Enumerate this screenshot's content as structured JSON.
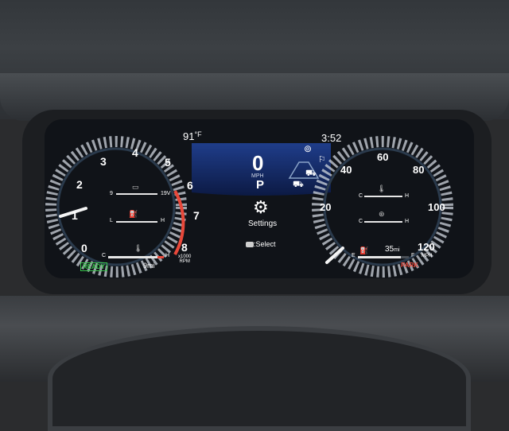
{
  "top": {
    "temperature": "91",
    "temp_unit": "°F",
    "time": "3:52"
  },
  "left_gauge": {
    "ticks": [
      "0",
      "1",
      "2",
      "3",
      "4",
      "5",
      "6",
      "7",
      "8"
    ],
    "unit_line1": "x1000",
    "unit_line2": "RPM",
    "ready": "READY",
    "trip": "9mi",
    "battery": {
      "low": "9",
      "high": "19V"
    },
    "oil": {
      "low": "L",
      "high": "H"
    },
    "coolant": {
      "low": "C",
      "high": "H"
    }
  },
  "center": {
    "speed": "0",
    "speed_unit": "MPH",
    "gear": "P",
    "menu_label": "Settings",
    "select_hint": ":Select",
    "select_icon": "ok-button-icon"
  },
  "right_gauge": {
    "ticks": [
      "20",
      "40",
      "60",
      "80",
      "100",
      "120"
    ],
    "unit": "MPH",
    "fuel_range": "35",
    "fuel_range_unit": "mi",
    "park": "PARK",
    "fuel": {
      "low": "E",
      "high": "F",
      "level": 0.85
    },
    "gauge1": {
      "low": "C",
      "high": "H"
    },
    "gauge2": {
      "low": "C",
      "high": "H"
    }
  },
  "colors": {
    "ready": "#36c24a",
    "park": "#e8483a",
    "redline": "#e8483a",
    "accent": "#2d76c8"
  }
}
